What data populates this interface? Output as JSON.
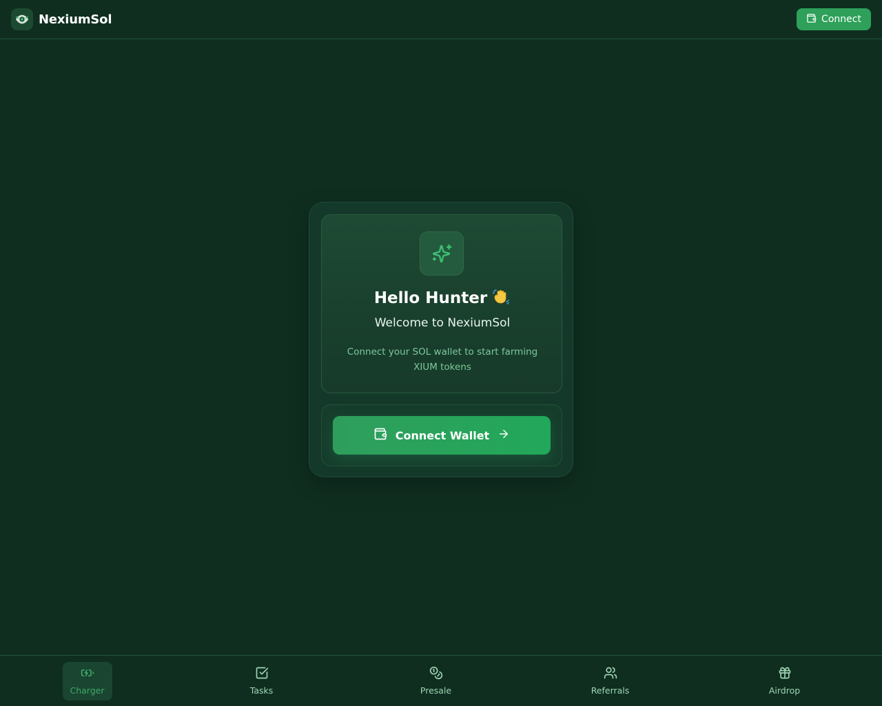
{
  "header": {
    "brand_name": "NexiumSol",
    "logo_icon": "eye-logo-icon",
    "connect_label": "Connect",
    "connect_icon": "wallet-icon"
  },
  "card": {
    "icon": "sparkles-icon",
    "greeting": "Hello Hunter",
    "greeting_emoji": "👋",
    "welcome": "Welcome to NexiumSol",
    "description": "Connect your SOL wallet to start farming XIUM tokens",
    "button_label": "Connect Wallet",
    "button_icon": "wallet-icon",
    "button_trailing_icon": "arrow-right-icon"
  },
  "bottom_nav": {
    "items": [
      {
        "label": "Charger",
        "icon": "battery-charging-icon",
        "active": true
      },
      {
        "label": "Tasks",
        "icon": "checkbox-icon",
        "active": false
      },
      {
        "label": "Presale",
        "icon": "coins-icon",
        "active": false
      },
      {
        "label": "Referrals",
        "icon": "users-icon",
        "active": false
      },
      {
        "label": "Airdrop",
        "icon": "gift-icon",
        "active": false
      }
    ]
  },
  "colors": {
    "background": "#0f2e20",
    "accent": "#2ea05a",
    "accent_text": "#7ec99b"
  }
}
